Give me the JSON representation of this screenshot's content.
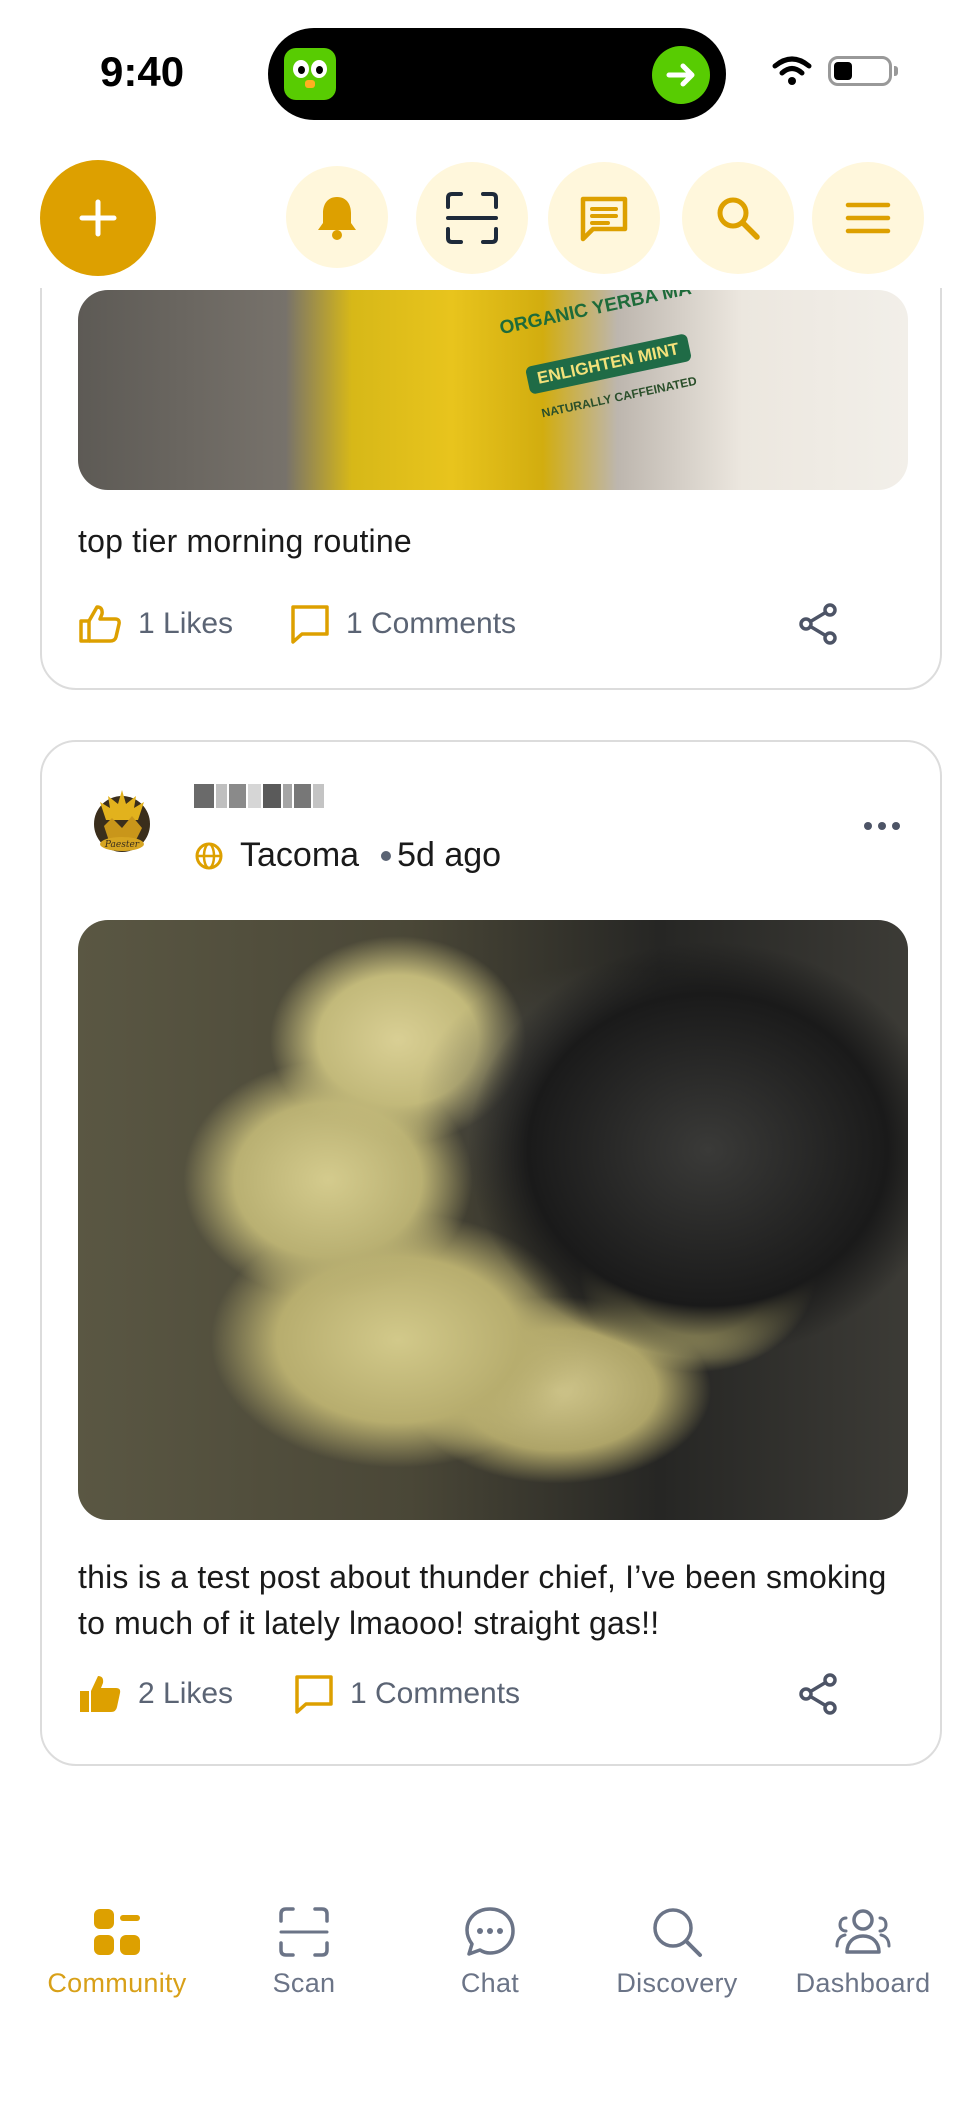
{
  "status_bar": {
    "time": "9:40"
  },
  "top_bar": {
    "add_icon": "plus-icon",
    "buttons": [
      "bell-icon",
      "scan-icon",
      "message-icon",
      "search-icon",
      "menu-icon"
    ]
  },
  "posts": [
    {
      "image_text": {
        "line1": "ORGANIC YERBA MA",
        "line2": "ENLIGHTEN MINT",
        "line3": "NATURALLY CAFFEINATED"
      },
      "caption": "top tier morning routine",
      "likes": "1 Likes",
      "comments": "1 Comments",
      "liked": false
    },
    {
      "location": "Tacoma",
      "time_ago": "5d ago",
      "caption": "this is a test post about thunder chief, I’ve been smoking to much of it lately lmaooo! straight gas!!",
      "likes": "2 Likes",
      "comments": "1 Comments",
      "liked": true
    }
  ],
  "bottom_nav": [
    {
      "label": "Community",
      "icon": "community-icon",
      "active": true
    },
    {
      "label": "Scan",
      "icon": "scan-icon",
      "active": false
    },
    {
      "label": "Chat",
      "icon": "chat-icon",
      "active": false
    },
    {
      "label": "Discovery",
      "icon": "discovery-icon",
      "active": false
    },
    {
      "label": "Dashboard",
      "icon": "dashboard-icon",
      "active": false
    }
  ],
  "colors": {
    "accent": "#dda000",
    "accent_light": "#fff7dc",
    "muted_text": "#5b6474",
    "border": "#dcdcdc"
  }
}
